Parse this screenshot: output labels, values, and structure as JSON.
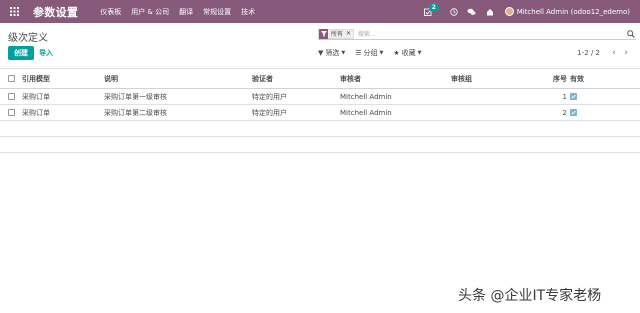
{
  "navbar": {
    "app_title": "参数设置",
    "menu": [
      "仪表板",
      "用户 & 公司",
      "翻译",
      "常规设置",
      "技术"
    ],
    "activity_count": "2",
    "user_name": "Mitchell Admin (odoo12_edemo)",
    "colors": {
      "bar": "#875a7b",
      "accent": "#00a09d"
    }
  },
  "control": {
    "breadcrumb": "级次定义",
    "create_label": "创建",
    "import_label": "导入",
    "search": {
      "facet": "所有",
      "placeholder": "搜索..."
    },
    "filters": {
      "filter_label": "筛选",
      "group_label": "分组",
      "favorites_label": "收藏"
    },
    "pager": "1-2 / 2"
  },
  "table": {
    "columns": {
      "model": "引用模型",
      "desc": "说明",
      "verifier": "验证者",
      "reviewer": "审核者",
      "group": "审核组",
      "seq": "序号",
      "active": "有效"
    },
    "rows": [
      {
        "model": "采购订单",
        "desc": "采购订单第一级审核",
        "verifier": "特定的用户",
        "reviewer": "Mitchell Admin",
        "group": "",
        "seq": "1",
        "active": true
      },
      {
        "model": "采购订单",
        "desc": "采购订单第二级审核",
        "verifier": "特定的用户",
        "reviewer": "Mitchell Admin",
        "group": "",
        "seq": "2",
        "active": true
      }
    ]
  },
  "watermark": "头条 @企业IT专家老杨"
}
